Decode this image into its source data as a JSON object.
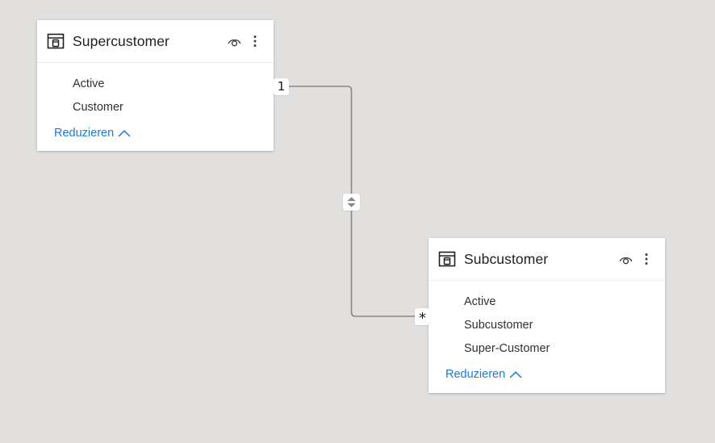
{
  "canvas": {
    "background_color": "#e1e0de",
    "accent_color": "#1a7ad4",
    "line_color": "#8a8886",
    "card_background": "#ffffff",
    "text_color": "#323130"
  },
  "entities": [
    {
      "id": "supercustomer",
      "title": "Supercustomer",
      "table_icon": "table-icon",
      "visibility_icon": "eye-icon",
      "more_options_icon": "ellipsis-vertical-icon",
      "fields": [
        "Active",
        "Customer"
      ],
      "collapse_label": "Reduzieren",
      "collapse_icon": "chevron-up-icon"
    },
    {
      "id": "subcustomer",
      "title": "Subcustomer",
      "table_icon": "table-icon",
      "visibility_icon": "eye-icon",
      "more_options_icon": "ellipsis-vertical-icon",
      "fields": [
        "Active",
        "Subcustomer",
        "Super-Customer"
      ],
      "collapse_label": "Reduzieren",
      "collapse_icon": "chevron-up-icon"
    }
  ],
  "relationship": {
    "from_cardinality": "1",
    "to_cardinality": "*",
    "cross_filter_icon": "both-directions-icon",
    "cross_filter_direction": "both"
  }
}
